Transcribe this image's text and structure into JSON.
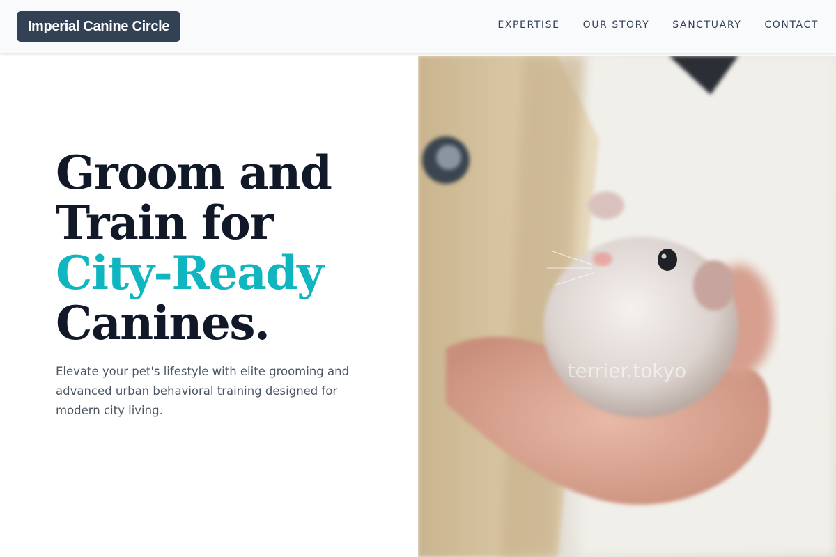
{
  "brand": {
    "name": "Imperial Canine Circle"
  },
  "nav": {
    "items": [
      {
        "label": "EXPERTISE"
      },
      {
        "label": "OUR STORY"
      },
      {
        "label": "SANCTUARY"
      },
      {
        "label": "CONTACT"
      }
    ]
  },
  "hero": {
    "headline_line1": "Groom and",
    "headline_line2": "Train for",
    "headline_accent": "City-Ready",
    "headline_line4": "Canines.",
    "subtext": "Elevate your pet's lifestyle with elite grooming and advanced urban behavioral training designed for modern city living.",
    "image_watermark": "terrier.tokyo"
  },
  "colors": {
    "nav_bg": "#f8fafc",
    "logo_bg": "#334155",
    "headline": "#111827",
    "accent": "#0fb5bf",
    "body_text": "#4b5563"
  }
}
